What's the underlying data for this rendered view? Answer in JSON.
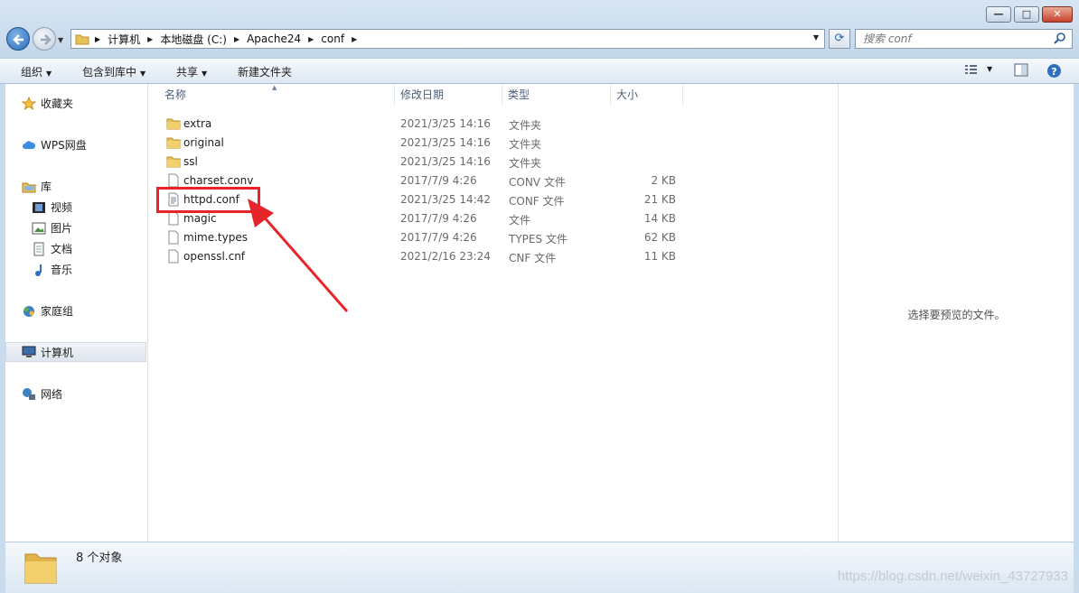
{
  "window": {
    "minimize_glyph": "—",
    "maximize_glyph": "□",
    "close_glyph": "✕"
  },
  "address": {
    "crumbs": [
      "计算机",
      "本地磁盘 (C:)",
      "Apache24",
      "conf"
    ]
  },
  "search": {
    "placeholder": "搜索 conf"
  },
  "toolbar": {
    "organize": "组织",
    "include_library": "包含到库中",
    "share": "共享",
    "new_folder": "新建文件夹"
  },
  "nav": {
    "favorites": "收藏夹",
    "wps": "WPS网盘",
    "libraries": "库",
    "videos": "视频",
    "pictures": "图片",
    "documents": "文档",
    "music": "音乐",
    "homegroup": "家庭组",
    "computer": "计算机",
    "network": "网络"
  },
  "columns": {
    "name": "名称",
    "date": "修改日期",
    "type": "类型",
    "size": "大小"
  },
  "files": [
    {
      "name": "extra",
      "date": "2021/3/25 14:16",
      "type": "文件夹",
      "size": "",
      "icon": "folder-icon"
    },
    {
      "name": "original",
      "date": "2021/3/25 14:16",
      "type": "文件夹",
      "size": "",
      "icon": "folder-icon"
    },
    {
      "name": "ssl",
      "date": "2021/3/25 14:16",
      "type": "文件夹",
      "size": "",
      "icon": "folder-icon"
    },
    {
      "name": "charset.conv",
      "date": "2017/7/9 4:26",
      "type": "CONV 文件",
      "size": "2 KB",
      "icon": "file-icon"
    },
    {
      "name": "httpd.conf",
      "date": "2021/3/25 14:42",
      "type": "CONF 文件",
      "size": "21 KB",
      "icon": "text-file-icon"
    },
    {
      "name": "magic",
      "date": "2017/7/9 4:26",
      "type": "文件",
      "size": "14 KB",
      "icon": "file-icon"
    },
    {
      "name": "mime.types",
      "date": "2017/7/9 4:26",
      "type": "TYPES 文件",
      "size": "62 KB",
      "icon": "file-icon"
    },
    {
      "name": "openssl.cnf",
      "date": "2021/2/16 23:24",
      "type": "CNF 文件",
      "size": "11 KB",
      "icon": "file-icon"
    }
  ],
  "preview": {
    "message": "选择要预览的文件。"
  },
  "status": {
    "count": "8 个对象"
  },
  "watermark": "https://blog.csdn.net/weixin_43727933",
  "colors": {
    "highlight": "#e8242b",
    "arrow": "#e8242b"
  }
}
